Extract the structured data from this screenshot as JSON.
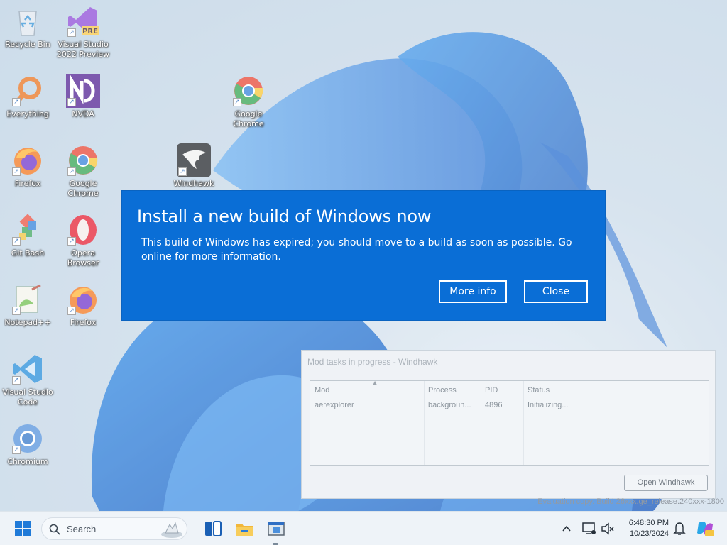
{
  "desktop": {
    "icons": [
      {
        "label": "Recycle Bin",
        "icon": "recycle-bin-icon"
      },
      {
        "label": "Visual Studio 2022 Preview",
        "icon": "visual-studio-preview-icon",
        "badge": "PRE"
      },
      {
        "label": "Everything",
        "icon": "everything-search-icon"
      },
      {
        "label": "NVDA",
        "icon": "nvda-icon"
      },
      {
        "label": "Google Chrome",
        "icon": "chrome-icon"
      },
      {
        "label": "Firefox",
        "icon": "firefox-icon"
      },
      {
        "label": "Google Chrome",
        "icon": "chrome-icon"
      },
      {
        "label": "Windhawk",
        "icon": "windhawk-icon"
      },
      {
        "label": "Git Bash",
        "icon": "git-bash-icon"
      },
      {
        "label": "Opera Browser",
        "icon": "opera-icon"
      },
      {
        "label": "Notepad++",
        "icon": "notepad-plus-plus-icon"
      },
      {
        "label": "Firefox",
        "icon": "firefox-icon"
      },
      {
        "label": "Visual Studio Code",
        "icon": "vscode-icon"
      },
      {
        "label": "Chromium",
        "icon": "chromium-icon"
      }
    ]
  },
  "banner": {
    "title": "Install a new build of Windows now",
    "message": "This build of Windows has expired; you should move to a build as soon as possible. Go online for more information.",
    "more_info_label": "More info",
    "close_label": "Close",
    "background": "#0a6ed6"
  },
  "windhawk_window": {
    "title": "Mod tasks in progress - Windhawk",
    "columns": [
      "Mod",
      "Process",
      "PID",
      "Status"
    ],
    "rows": [
      {
        "mod": "aerexplorer",
        "process": "backgroun...",
        "pid": "4896",
        "status": "Initializing..."
      }
    ],
    "open_button_label": "Open Windhawk"
  },
  "watermark": "Evaluation copy. Build 26xxx.ge_release.240xxx-1800",
  "taskbar": {
    "search_placeholder": "Search",
    "time": "6:48:30 PM",
    "date": "10/23/2024",
    "pinned": [
      "start-icon",
      "search-icon",
      "task-view-icon",
      "file-explorer-icon",
      "windhawk-taskbar-icon"
    ],
    "tray": [
      "chevron-up-icon",
      "network-icon",
      "volume-muted-icon",
      "notification-bell-icon",
      "copilot-icon"
    ]
  }
}
